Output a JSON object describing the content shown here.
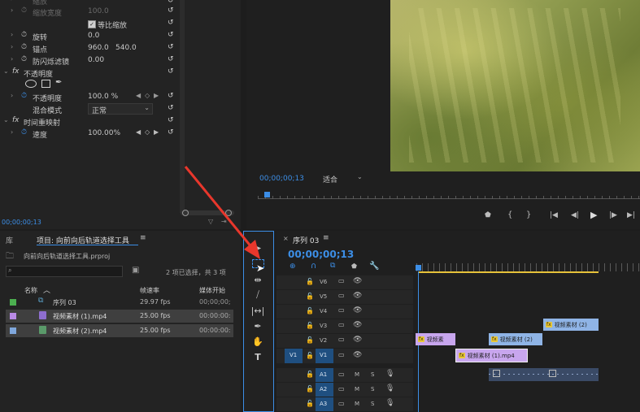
{
  "effect_controls": {
    "rows": {
      "scale": "缩放",
      "scale_width": "缩放宽度",
      "scale_width_value": "100.0",
      "uniform_scale": "等比缩放",
      "rotation": "旋转",
      "rotation_value": "0.0",
      "anchor": "锚点",
      "anchor_x": "960.0",
      "anchor_y": "540.0",
      "anti_flicker": "防闪烁滤镜",
      "anti_flicker_value": "0.00",
      "opacity_section": "不透明度",
      "opacity": "不透明度",
      "opacity_value": "100.0 %",
      "blend_mode": "混合模式",
      "blend_mode_value": "正常",
      "time_remap": "时间重映射",
      "speed": "速度",
      "speed_value": "100.00%"
    },
    "timecode": "00;00;00;13"
  },
  "program_monitor": {
    "timecode": "00;00;00;13",
    "fit": "适合"
  },
  "project_panel": {
    "tab_library": "库",
    "tab_project": "项目: 向前向后轨道选择工具",
    "project_file": "向前向后轨道选择工具.prproj",
    "selection_info": "2 项已选择，共 3 项",
    "col_name": "名称",
    "col_framerate": "帧速率",
    "col_media_start": "媒体开始",
    "items": [
      {
        "name": "序列 03",
        "fps": "29.97 fps",
        "start": "00;00;00;",
        "color": "#4caf50"
      },
      {
        "name": "视频素材 (1).mp4",
        "fps": "25.00 fps",
        "start": "00:00:00:",
        "color": "#b98ae6"
      },
      {
        "name": "视频素材 (2).mp4",
        "fps": "25.00 fps",
        "start": "00:00:00:",
        "color": "#7fa7dc"
      }
    ]
  },
  "timeline": {
    "tab": "序列 03",
    "timecode": "00;00;00;13",
    "tracks_video": [
      "V6",
      "V5",
      "V4",
      "V3",
      "V2",
      "V1"
    ],
    "tracks_audio": [
      "A1",
      "A2",
      "A3"
    ],
    "source_v1": "V1",
    "audio_m": "M",
    "audio_s": "S",
    "clips": {
      "v3_clip": "视频素材 (2)",
      "v2_clip_a": "视频素",
      "v2_clip_b": "视频素材 (2)",
      "v1_clip": "视频素材 (1).mp4"
    }
  },
  "tools": [
    "selection",
    "track-select-forward",
    "ripple-edit",
    "razor",
    "slip",
    "pen",
    "hand",
    "type"
  ],
  "colors": {
    "accent_blue": "#3c8ee6",
    "clip_purple": "#c8a6ee",
    "clip_blue": "#8fb4e6",
    "audio_clip": "#3a4a66",
    "arrow_red": "#e8372c"
  }
}
